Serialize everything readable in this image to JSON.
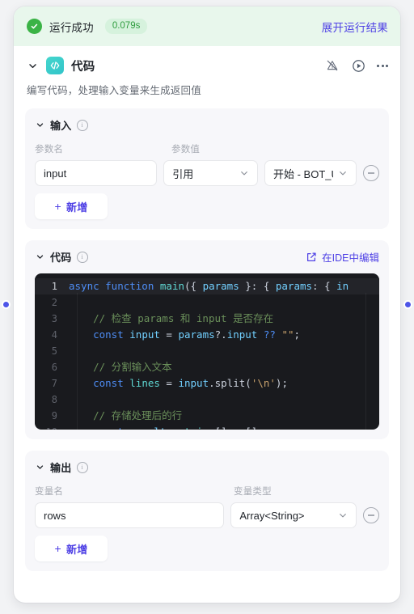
{
  "run_banner": {
    "status_icon": "check-circle-icon",
    "status_text": "运行成功",
    "duration": "0.079s",
    "expand_link": "展开运行结果",
    "accent_green": "#3bb346",
    "badge_bg": "#d6f2dd",
    "banner_bg": "#e8f7ec",
    "link_color": "#4e40e5"
  },
  "node": {
    "collapse_icon": "chevron-down-icon",
    "icon_glyph": "</>",
    "icon_color": "#3ecfc9",
    "title": "代码",
    "description": "编写代码，处理输入变量来生成返回值",
    "actions": {
      "warning_muted": "warning-off-icon",
      "run": "play-circle-icon",
      "more": "more-horizontal-icon"
    }
  },
  "input_section": {
    "title": "输入",
    "info_icon": "info-icon",
    "columns": [
      "参数名",
      "参数值"
    ],
    "rows": [
      {
        "name": "input",
        "ref_type": "引用",
        "ref_value": "开始 - BOT_US",
        "remove_icon": "minus-circle-icon"
      }
    ],
    "add_label": "新增",
    "add_icon": "plus-icon"
  },
  "code_section": {
    "title": "代码",
    "info_icon": "info-icon",
    "ide_link": "在IDE中编辑",
    "ide_icon": "edit-square-icon",
    "editor": {
      "active_line": 1,
      "background": "#191a1e",
      "lines": [
        {
          "n": "1",
          "tokens": [
            {
              "t": "async ",
              "c": "kw"
            },
            {
              "t": "function ",
              "c": "kw"
            },
            {
              "t": "main",
              "c": "fn"
            },
            {
              "t": "({ ",
              "c": "pun"
            },
            {
              "t": "params",
              "c": "var"
            },
            {
              "t": " }: { ",
              "c": "pun"
            },
            {
              "t": "params",
              "c": "var"
            },
            {
              "t": ": { ",
              "c": "pun"
            },
            {
              "t": "in",
              "c": "var"
            }
          ]
        },
        {
          "n": "2",
          "tokens": []
        },
        {
          "n": "3",
          "tokens": [
            {
              "t": "    // 检查 params 和 input 是否存在",
              "c": "com"
            }
          ]
        },
        {
          "n": "4",
          "tokens": [
            {
              "t": "    ",
              "c": "pun"
            },
            {
              "t": "const ",
              "c": "kw"
            },
            {
              "t": "input",
              "c": "var"
            },
            {
              "t": " = ",
              "c": "pun"
            },
            {
              "t": "params",
              "c": "var"
            },
            {
              "t": "?.",
              "c": "pun"
            },
            {
              "t": "input ",
              "c": "var"
            },
            {
              "t": "?? ",
              "c": "kw"
            },
            {
              "t": "\"\"",
              "c": "str"
            },
            {
              "t": ";",
              "c": "pun"
            }
          ]
        },
        {
          "n": "5",
          "tokens": []
        },
        {
          "n": "6",
          "tokens": [
            {
              "t": "    // 分割输入文本",
              "c": "com"
            }
          ]
        },
        {
          "n": "7",
          "tokens": [
            {
              "t": "    ",
              "c": "pun"
            },
            {
              "t": "const ",
              "c": "kw"
            },
            {
              "t": "lines",
              "c": "fn"
            },
            {
              "t": " = ",
              "c": "pun"
            },
            {
              "t": "input",
              "c": "var"
            },
            {
              "t": ".split(",
              "c": "pun"
            },
            {
              "t": "'\\n'",
              "c": "str"
            },
            {
              "t": ");",
              "c": "pun"
            }
          ]
        },
        {
          "n": "8",
          "tokens": []
        },
        {
          "n": "9",
          "tokens": [
            {
              "t": "    // 存储处理后的行",
              "c": "com"
            }
          ]
        },
        {
          "n": "10",
          "tokens": [
            {
              "t": "    ",
              "c": "pun"
            },
            {
              "t": "const ",
              "c": "kw"
            },
            {
              "t": "result",
              "c": "var"
            },
            {
              "t": ": ",
              "c": "pun"
            },
            {
              "t": "string",
              "c": "fn"
            },
            {
              "t": "[] = [];",
              "c": "pun"
            }
          ]
        }
      ]
    }
  },
  "output_section": {
    "title": "输出",
    "info_icon": "info-icon",
    "columns": [
      "变量名",
      "变量类型"
    ],
    "rows": [
      {
        "name": "rows",
        "type": "Array<String>",
        "remove_icon": "minus-circle-icon"
      }
    ],
    "add_label": "新增",
    "add_icon": "plus-icon"
  },
  "ports": {
    "color": "#4e55e8",
    "left": "input-port",
    "right": "output-port"
  }
}
